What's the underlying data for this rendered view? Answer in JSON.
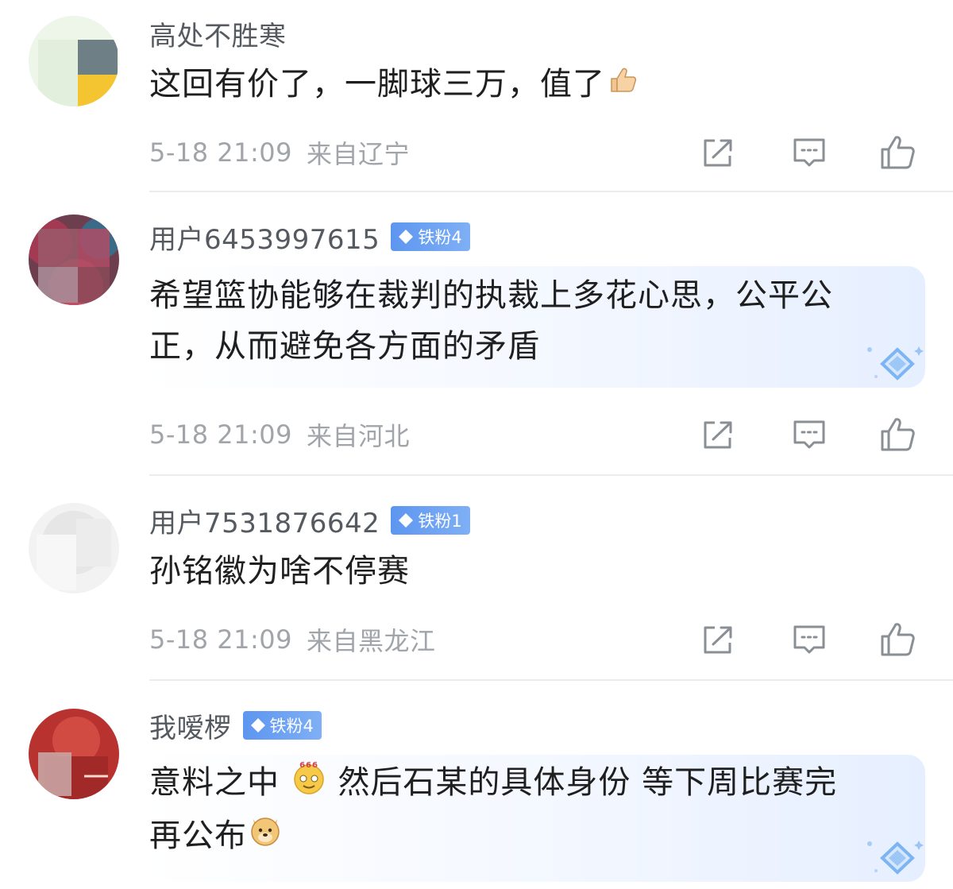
{
  "comments": [
    {
      "username": "高处不胜寒",
      "badge": "",
      "lines": [
        "这回有价了，一脚球三万，值了"
      ],
      "emoji_names": [
        "thumbs-up-emoji"
      ],
      "time": "5-18 21:09",
      "location": "来自辽宁"
    },
    {
      "username": "用户6453997615",
      "badge": "铁粉4",
      "lines": [
        "希望篮协能够在裁判的执裁上多花心思，公平公",
        "正，从而避免各方面的矛盾"
      ],
      "time": "5-18 21:09",
      "location": "来自河北"
    },
    {
      "username": "用户7531876642",
      "badge": "铁粉1",
      "lines": [
        "孙铭徽为啥不停赛"
      ],
      "time": "5-18 21:09",
      "location": "来自黑龙江"
    },
    {
      "username": "我嗳椤",
      "badge": "铁粉4",
      "line1_a": "意料之中",
      "line1_b": "然后石某的具体身份 等下周比赛完",
      "line2": "再公布",
      "emoji_names": [
        "666-emoji",
        "doge-emoji"
      ],
      "emoji_666_text": "666"
    }
  ],
  "icons": {
    "share": "share-icon",
    "reply": "comment-icon",
    "like": "thumbs-up-icon",
    "badge": "diamond-icon"
  },
  "colors": {
    "badge": "#5d96f0",
    "meta": "#a1a5aa",
    "username": "#555a60",
    "divider": "#ececec"
  }
}
